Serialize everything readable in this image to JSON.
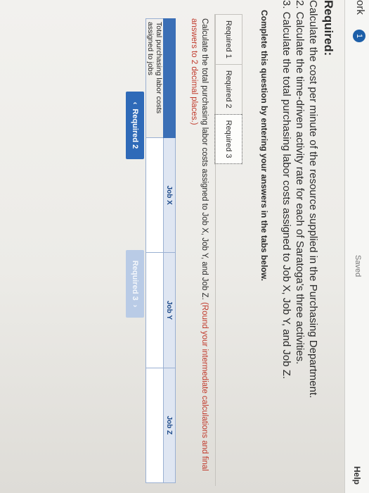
{
  "header": {
    "work_label": "ork",
    "badge": "1",
    "saved": "Saved",
    "help": "Help"
  },
  "required": {
    "title": "Required:",
    "items": [
      "Calculate the cost per minute of the resource supplied in the Purchasing Department.",
      "2. Calculate the time-driven activity rate for each of Saratoga's three activities.",
      "3. Calculate the total purchasing labor costs assigned to Job X, Job Y, and Job Z."
    ]
  },
  "instruction": "Complete this question by entering your answers in the tabs below.",
  "tabs": [
    {
      "label": "Required 1",
      "active": false
    },
    {
      "label": "Required 2",
      "active": false
    },
    {
      "label": "Required 3",
      "active": true
    }
  ],
  "active_tab": {
    "prompt": "Calculate the total purchasing labor costs assigned to Job X, Job Y, and Job Z.",
    "hint": "(Round your intermediate calculations and final answers to 2 decimal places.)",
    "columns": [
      "Job X",
      "Job Y",
      "Job Z"
    ],
    "row_label": "Total purchasing labor costs assigned to jobs",
    "values": [
      "",
      "",
      ""
    ]
  },
  "nav": {
    "prev_label": "Required 2",
    "prev_icon": "chevron-left-icon",
    "next_label": "Required 3",
    "next_icon": "chevron-right-icon"
  },
  "colors": {
    "accent": "#2f6ab8",
    "disabled": "#b9cbe6",
    "hint": "#c0392b",
    "header_cell": "#dfe6f2"
  }
}
